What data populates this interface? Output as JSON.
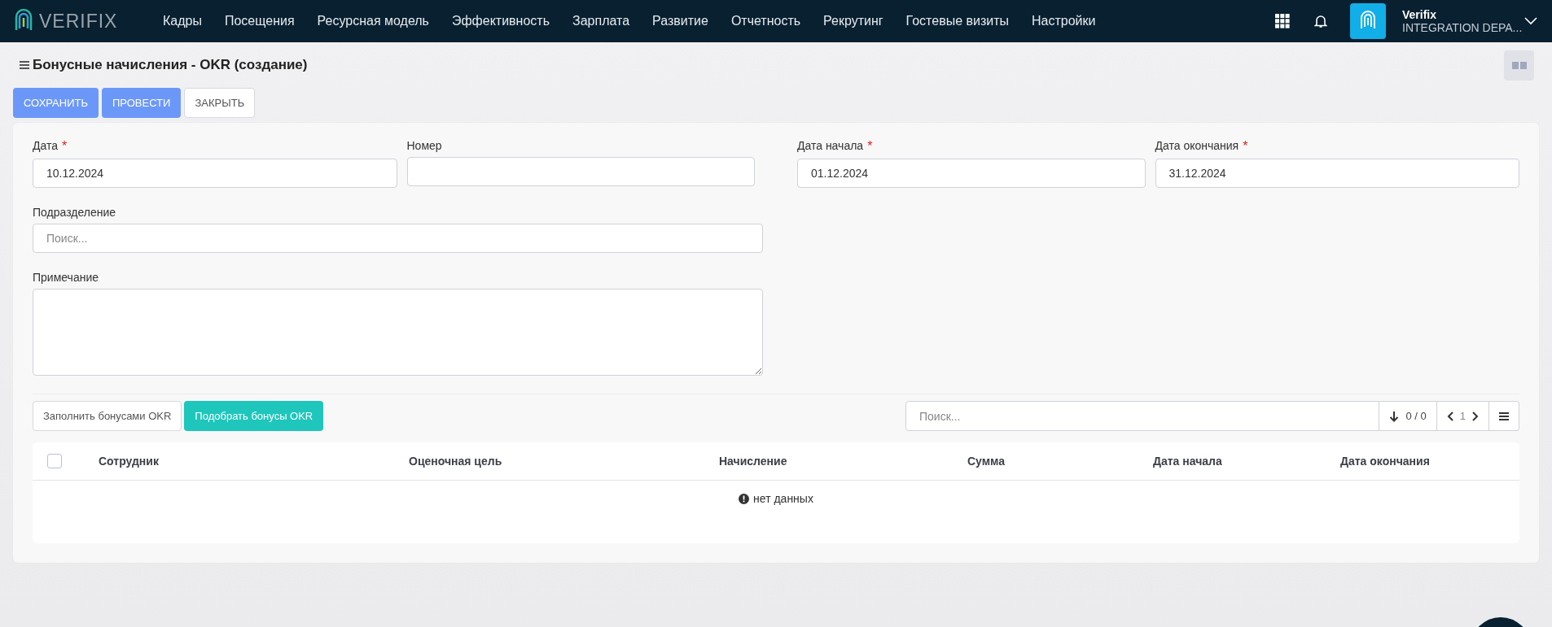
{
  "header": {
    "logo_text": "VERIFIX",
    "nav": [
      {
        "label": "Кадры"
      },
      {
        "label": "Посещения"
      },
      {
        "label": "Ресурсная модель"
      },
      {
        "label": "Эффективность"
      },
      {
        "label": "Зарплата"
      },
      {
        "label": "Развитие"
      },
      {
        "label": "Отчетность"
      },
      {
        "label": "Рекрутинг"
      },
      {
        "label": "Гостевые визиты"
      },
      {
        "label": "Настройки"
      }
    ],
    "user": {
      "name": "Verifix",
      "org": "INTEGRATION DEPA..."
    }
  },
  "page": {
    "title": "Бонусные начисления - OKR (создание)",
    "actions": [
      {
        "label": "СОХРАНИТЬ",
        "kind": "primary"
      },
      {
        "label": "ПРОВЕСТИ",
        "kind": "primary"
      },
      {
        "label": "ЗАКРЫТЬ",
        "kind": "default"
      }
    ]
  },
  "form": {
    "row1": [
      {
        "label": "Дата",
        "required": true,
        "value": "10.12.2024"
      },
      {
        "label": "Номер",
        "required": false
      },
      {
        "label": "Дата начала",
        "required": true,
        "value": "01.12.2024"
      },
      {
        "label": "Дата окончания",
        "required": true,
        "value": "31.12.2024"
      }
    ],
    "required_mark": "*",
    "subdivision": {
      "label": "Подразделение",
      "placeholder": "Поиск..."
    },
    "note": {
      "label": "Примечание"
    }
  },
  "grid": {
    "buttons": [
      {
        "label": "Заполнить бонусами OKR",
        "kind": "default"
      },
      {
        "label": "Подобрать бонусы OKR",
        "kind": "accent"
      }
    ],
    "search": {
      "placeholder": "Поиск..."
    },
    "counter": "0 / 0",
    "page": "1",
    "select_all": {
      "checked": false
    },
    "columns": [
      "Сотрудник",
      "Оценочная цель",
      "Начисление",
      "Сумма",
      "Дата начала",
      "Дата окончания"
    ],
    "empty": "нет данных"
  }
}
